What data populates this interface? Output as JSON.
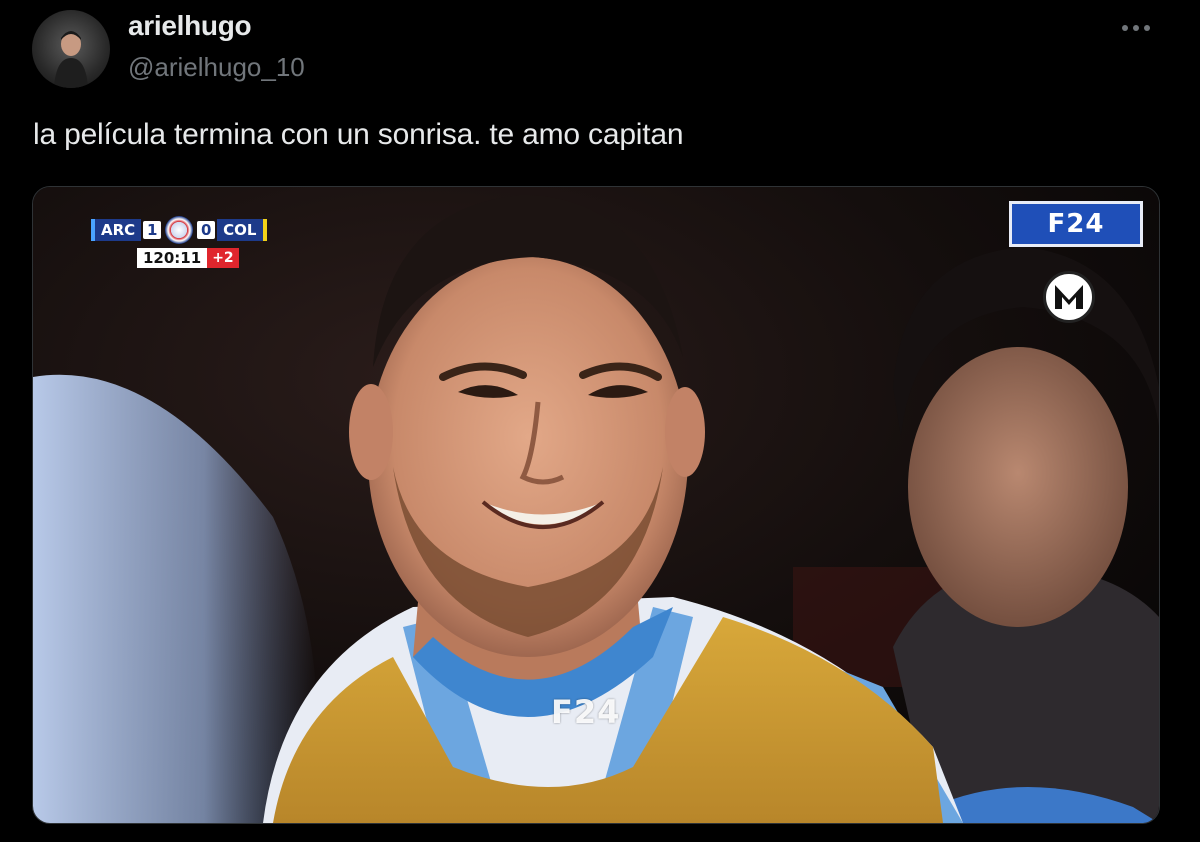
{
  "tweet": {
    "display_name": "arielhugo",
    "handle": "@arielhugo_10",
    "text": "la película termina con un sonrisa. te amo capitan",
    "more_icon": "more-horizontal-icon"
  },
  "media": {
    "scoreboard": {
      "home_team": "ARC",
      "home_score": "1",
      "away_score": "0",
      "away_team": "COL",
      "clock": "120:11",
      "added_time": "+2"
    },
    "channel_badge": "F24",
    "watermark": "F24",
    "corner_logo_icon": "m-logo-icon"
  },
  "colors": {
    "background": "#000000",
    "text_primary": "#e7e9ea",
    "text_secondary": "#71767b",
    "badge_blue": "#1f4fb8",
    "added_time_red": "#e0262d"
  }
}
